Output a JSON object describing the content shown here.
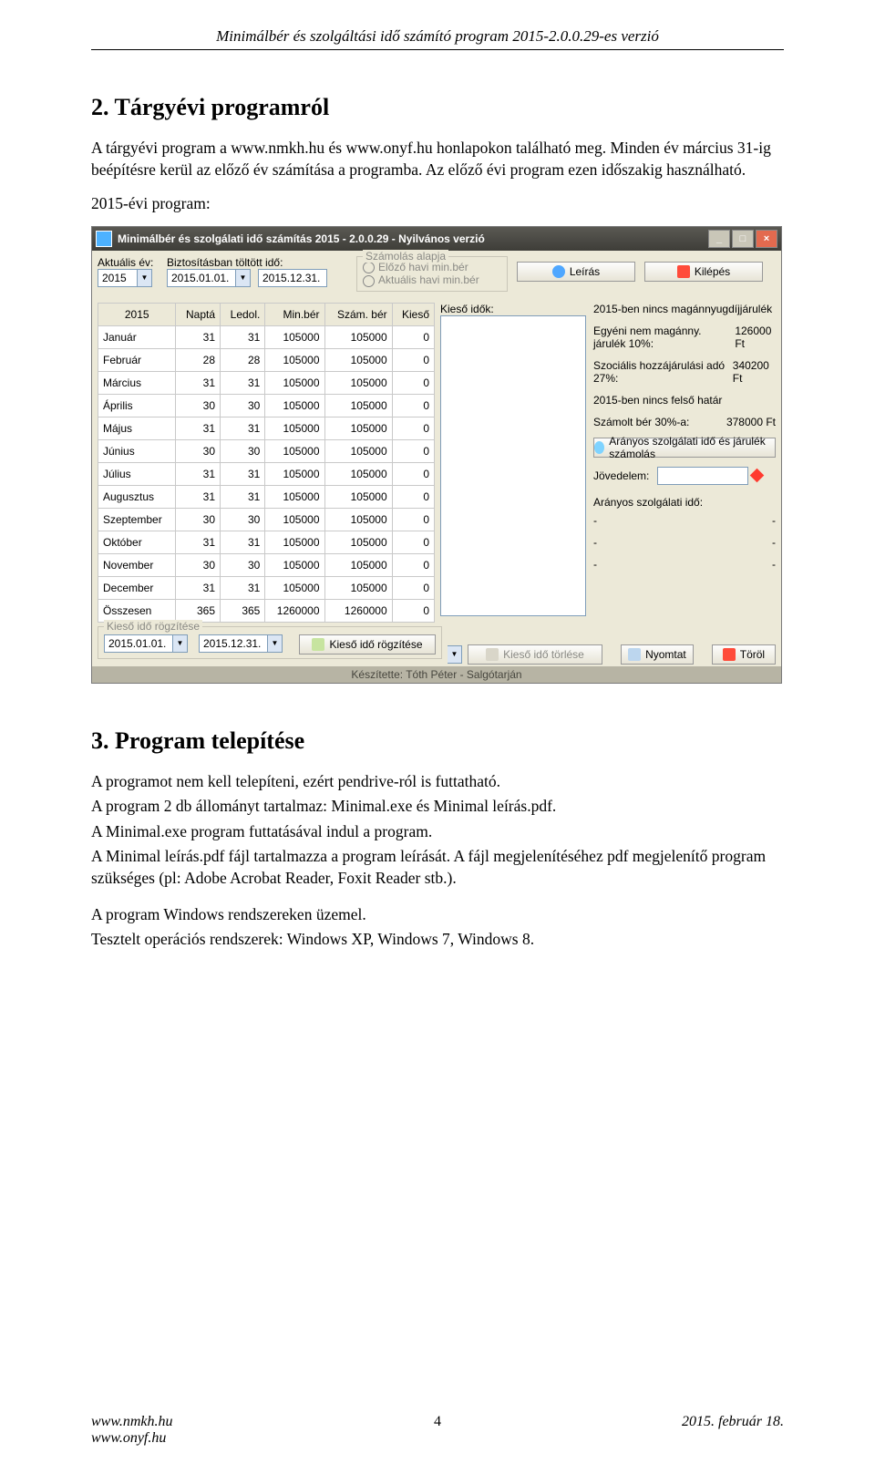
{
  "doc": {
    "header_title": "Minimálbér és szolgáltási idő számító program 2015-2.0.0.29-es verzió",
    "section2_title": "2.  Tárgyévi programról",
    "section2_para": "A tárgyévi program a www.nmkh.hu és www.onyf.hu honlapokon található meg. Minden év március 31-ig beépítésre kerül az előző év számítása a programba. Az előző évi program ezen időszakig használható.",
    "section2_line2": "2015-évi program:",
    "section3_title": "3.  Program telepítése",
    "section3_p1": "A programot nem kell telepíteni, ezért pendrive-ról is futtatható.",
    "section3_p2": "A program 2 db állományt tartalmaz: Minimal.exe és Minimal leírás.pdf.",
    "section3_p3": "A Minimal.exe program futtatásával indul a program.",
    "section3_p4": "A Minimal leírás.pdf fájl tartalmazza a program leírását. A fájl megjelenítéséhez pdf megjelenítő program szükséges (pl: Adobe Acrobat Reader, Foxit Reader stb.).",
    "section3_p5": "A program Windows rendszereken üzemel.",
    "section3_p6": "Tesztelt operációs rendszerek: Windows XP, Windows 7, Windows 8.",
    "footer_left1": "www.nmkh.hu",
    "footer_left2": "www.onyf.hu",
    "footer_center": "4",
    "footer_right": "2015. február 18."
  },
  "app": {
    "title": "Minimálbér és szolgálati idő számítás 2015 - 2.0.0.29 - Nyilvános verzió",
    "labels": {
      "aktualis_ev": "Aktuális év:",
      "biztositas": "Biztosításban töltött idő:",
      "szamolas_alapja": "Számolás alapja",
      "elozo_havi": "Előző havi min.bér",
      "aktualis_havi": "Aktuális havi min.bér",
      "leiras": "Leírás",
      "kilepes": "Kilépés",
      "kieso_idok": "Kieső idők:",
      "kieso_rogzitese_box": "Kieső idő rögzítése",
      "kieso_rogzitese_btn": "Kieső idő rögzítése",
      "kieso_torlese": "Kieső idő törlése",
      "nyomtat": "Nyomtat",
      "torol": "Töröl",
      "keszitette": "Készítette: Tóth Péter - Salgótarján"
    },
    "fields": {
      "ev": "2015",
      "date_from": "2015.01.01.",
      "date_to": "2015.12.31.",
      "kieso_from": "2015.01.01.",
      "kieso_to": "2015.12.31.",
      "jovedelem": ""
    },
    "right": {
      "line1": "2015-ben nincs magánnyugdíjjárulék",
      "line2_label": "Egyéni nem magánny. járulék 10%:",
      "line2_val": "126000 Ft",
      "line3_label": "Szociális hozzájárulási adó 27%:",
      "line3_val": "340200 Ft",
      "line4": "2015-ben nincs felső határ",
      "line5_label": "Számolt bér 30%-a:",
      "line5_val": "378000 Ft",
      "aranyos_btn": "Arányos szolgálati idő és járulék számolás",
      "jovedelem_lbl": "Jövedelem:",
      "aranyos_ido": "Arányos szolgálati idő:",
      "dash": "-"
    },
    "table": {
      "headers": [
        "2015",
        "Naptá",
        "Ledol.",
        "Min.bér",
        "Szám. bér",
        "Kieső"
      ],
      "rows": [
        [
          "Január",
          "31",
          "31",
          "105000",
          "105000",
          "0"
        ],
        [
          "Február",
          "28",
          "28",
          "105000",
          "105000",
          "0"
        ],
        [
          "Március",
          "31",
          "31",
          "105000",
          "105000",
          "0"
        ],
        [
          "Április",
          "30",
          "30",
          "105000",
          "105000",
          "0"
        ],
        [
          "Május",
          "31",
          "31",
          "105000",
          "105000",
          "0"
        ],
        [
          "Június",
          "30",
          "30",
          "105000",
          "105000",
          "0"
        ],
        [
          "Július",
          "31",
          "31",
          "105000",
          "105000",
          "0"
        ],
        [
          "Augusztus",
          "31",
          "31",
          "105000",
          "105000",
          "0"
        ],
        [
          "Szeptember",
          "30",
          "30",
          "105000",
          "105000",
          "0"
        ],
        [
          "Október",
          "31",
          "31",
          "105000",
          "105000",
          "0"
        ],
        [
          "November",
          "30",
          "30",
          "105000",
          "105000",
          "0"
        ],
        [
          "December",
          "31",
          "31",
          "105000",
          "105000",
          "0"
        ],
        [
          "Összesen",
          "365",
          "365",
          "1260000",
          "1260000",
          "0"
        ]
      ]
    }
  }
}
